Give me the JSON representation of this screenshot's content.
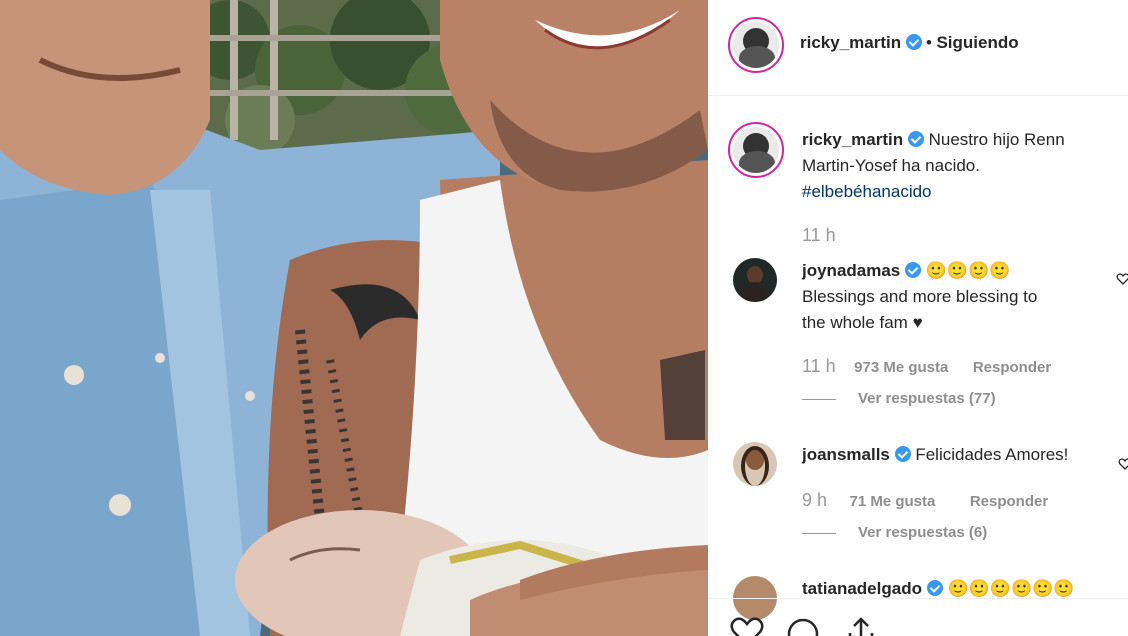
{
  "header": {
    "username": "ricky_martin",
    "separator": "•",
    "follow_status": "Siguiendo"
  },
  "caption": {
    "username": "ricky_martin",
    "line1": "Nuestro hijo Renn",
    "line2": "Martin-Yosef ha nacido.",
    "hashtag": "#elbebéhanacido",
    "time": "11 h"
  },
  "comments": [
    {
      "username": "joynadamas",
      "emoji": "🙂🙂🙂🙂",
      "line1": "Blessings and more blessing to",
      "line2": "the whole fam",
      "heart": "♥",
      "time": "11 h",
      "likes": "973 Me gusta",
      "reply": "Responder",
      "view_replies": "Ver respuestas (77)"
    },
    {
      "username": "joansmalls",
      "text": "Felicidades Amores!",
      "time": "9 h",
      "likes": "71 Me gusta",
      "reply": "Responder",
      "view_replies": "Ver respuestas (6)"
    },
    {
      "username": "tatianadelgado",
      "emoji": "🙂🙂🙂🙂🙂🙂"
    }
  ],
  "colors": {
    "verified": "#3897f0",
    "hashtag": "#003569",
    "muted": "#8e8e8e",
    "text": "#262626"
  }
}
